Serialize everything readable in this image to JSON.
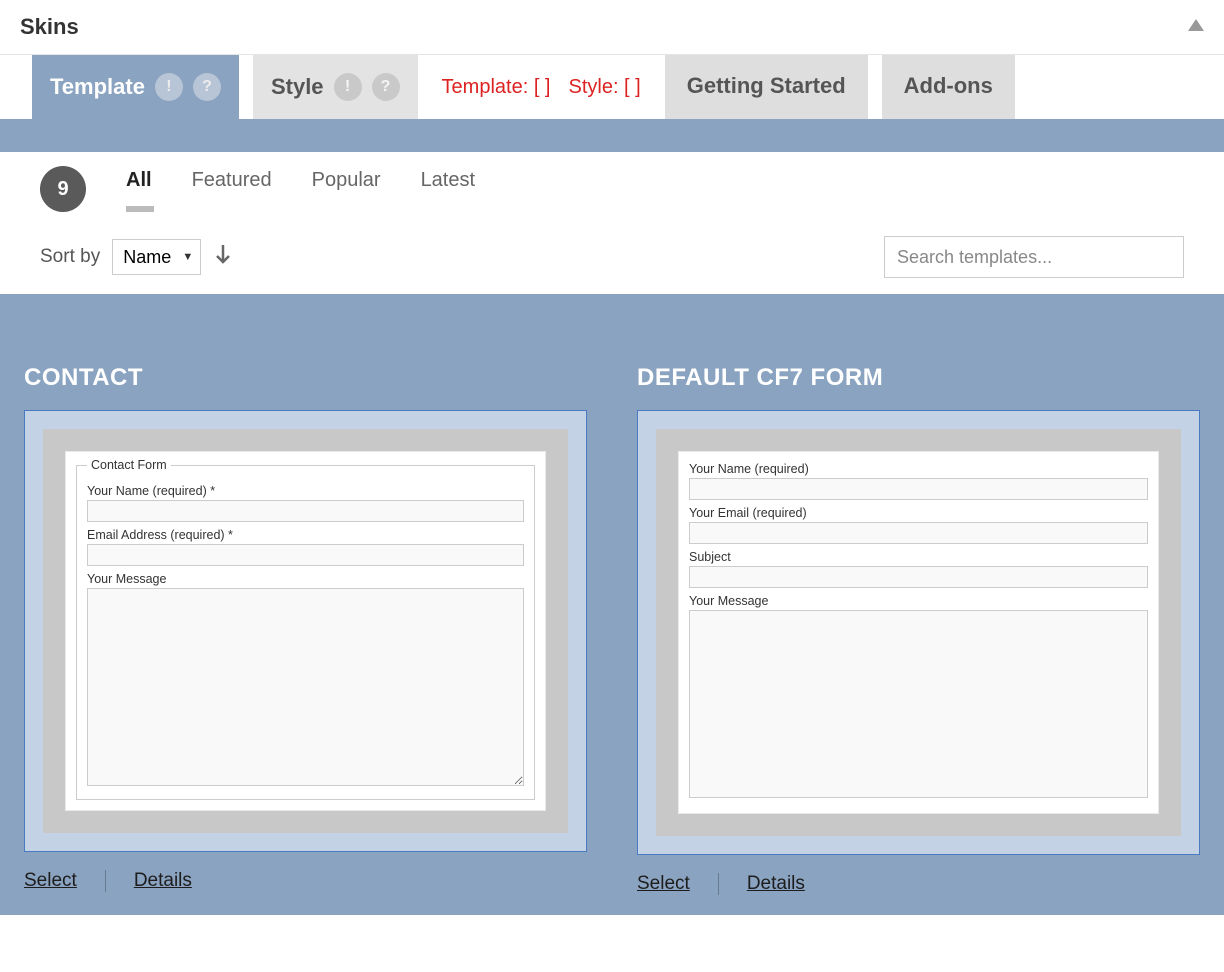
{
  "header": {
    "title": "Skins"
  },
  "tabs": {
    "template": {
      "label": "Template",
      "badge1": "!",
      "badge2": "?"
    },
    "style": {
      "label": "Style",
      "badge1": "!",
      "badge2": "?"
    },
    "status_template": "Template:  [   ]",
    "status_style": "Style:  [   ]",
    "getting_started": "Getting Started",
    "addons": "Add-ons"
  },
  "filters": {
    "count": "9",
    "tabs": {
      "all": "All",
      "featured": "Featured",
      "popular": "Popular",
      "latest": "Latest"
    },
    "sort_label": "Sort by",
    "sort_value": "Name",
    "search_placeholder": "Search templates..."
  },
  "templates": [
    {
      "title": "CONTACT",
      "legend": "Contact Form",
      "fields": [
        {
          "label": "Your Name (required) *",
          "type": "text"
        },
        {
          "label": "Email Address (required) *",
          "type": "text"
        },
        {
          "label": "Your Message",
          "type": "textarea"
        }
      ],
      "uses_fieldset": true
    },
    {
      "title": "DEFAULT CF7 FORM",
      "fields": [
        {
          "label": "Your Name (required)",
          "type": "text"
        },
        {
          "label": "Your Email (required)",
          "type": "text"
        },
        {
          "label": "Subject",
          "type": "text"
        },
        {
          "label": "Your Message",
          "type": "textarea"
        }
      ],
      "uses_fieldset": false
    }
  ],
  "actions": {
    "select": "Select",
    "details": "Details"
  }
}
